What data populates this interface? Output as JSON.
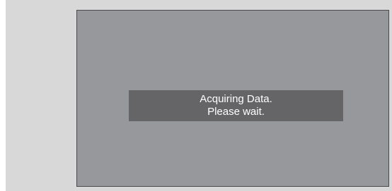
{
  "dialog": {
    "line1": "Acquiring Data.",
    "line2": "Please wait."
  },
  "colors": {
    "backdrop": "#d8d8d9",
    "screen": "#97989b",
    "message_box": "#656567",
    "message_text": "#ffffff"
  }
}
